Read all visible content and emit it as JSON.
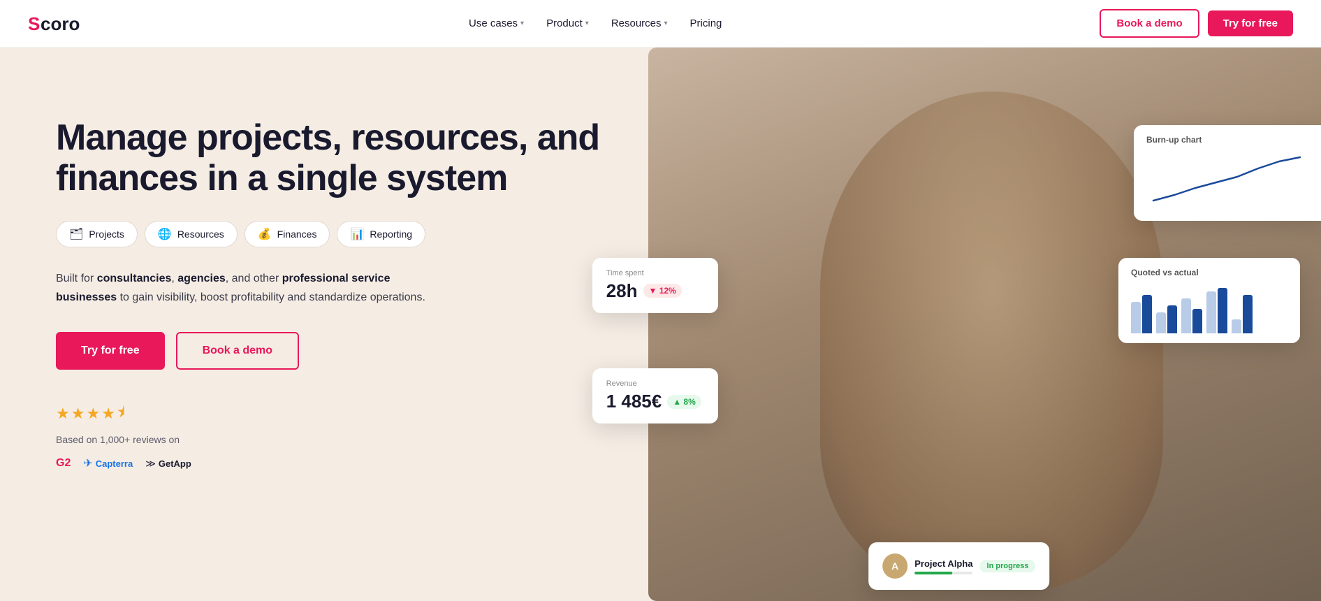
{
  "nav": {
    "logo_text": "Scoro",
    "links": [
      {
        "label": "Use cases",
        "has_dropdown": true
      },
      {
        "label": "Product",
        "has_dropdown": true
      },
      {
        "label": "Resources",
        "has_dropdown": true
      },
      {
        "label": "Pricing",
        "has_dropdown": false
      }
    ],
    "btn_demo": "Book a demo",
    "btn_try": "Try for free"
  },
  "hero": {
    "title": "Manage projects, resources, and finances in a single system",
    "tags": [
      {
        "label": "Projects",
        "icon": "🗂"
      },
      {
        "label": "Resources",
        "icon": "🌐"
      },
      {
        "label": "Finances",
        "icon": "💰"
      },
      {
        "label": "Reporting",
        "icon": "📊"
      }
    ],
    "description_part1": "Built for ",
    "description_bold1": "consultancies",
    "description_part2": ", ",
    "description_bold2": "agencies",
    "description_part3": ", and other ",
    "description_bold3": "professional service businesses",
    "description_part4": " to gain visibility, boost profitability and standardize operations.",
    "btn_try": "Try for free",
    "btn_demo": "Book a demo",
    "stars_label": "★★★★½",
    "review_text": "Based on 1,000+ reviews on",
    "review_logos": [
      "G2",
      "Capterra",
      "GetApp"
    ]
  },
  "cards": {
    "time_spent": {
      "label": "Time spent",
      "value": "28h",
      "badge": "▼ 12%",
      "badge_type": "down"
    },
    "revenue": {
      "label": "Revenue",
      "value": "1 485€",
      "badge": "▲ 8%",
      "badge_type": "up"
    },
    "burnup": {
      "title": "Burn-up chart"
    },
    "quoted": {
      "title": "Quoted vs actual"
    },
    "progress": {
      "name": "Project Alpha",
      "status": "In progress"
    }
  },
  "colors": {
    "brand_red": "#e8185a",
    "brand_dark": "#1a1a2e",
    "bg_hero": "#f5ede4",
    "bar_light": "#b8cce8",
    "bar_dark": "#1a4a9a"
  }
}
